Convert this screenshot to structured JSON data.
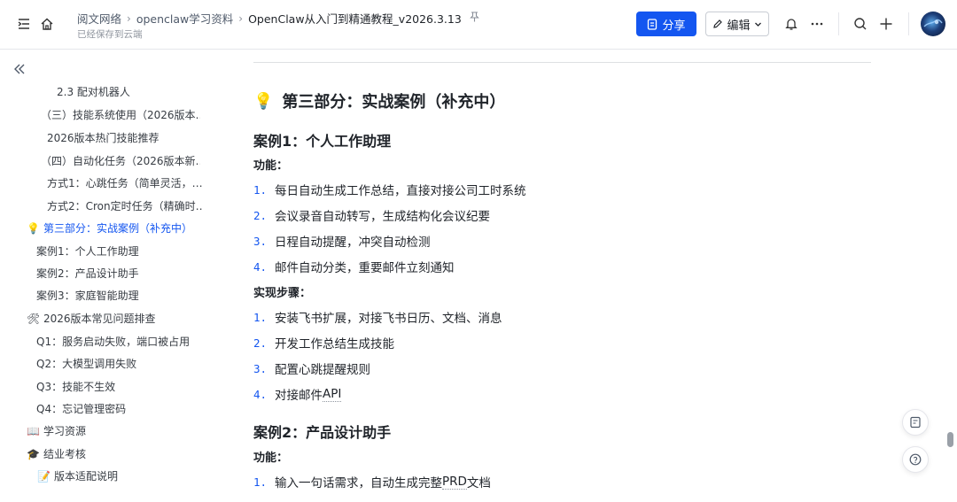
{
  "header": {
    "breadcrumbs": [
      "阅文网络",
      "openclaw学习资料",
      "OpenClaw从入门到精通教程_v2026.3.13"
    ],
    "saved_status": "已经保存到云端",
    "share_label": "分享",
    "edit_label": "编辑",
    "pin_icon": "pin-icon",
    "accent_color": "#1456f0"
  },
  "toc": {
    "items": [
      {
        "label": "2.3 配对机器人",
        "emoji": ""
      },
      {
        "label": "（三）技能系统使用（2026版本…",
        "emoji": ""
      },
      {
        "label": "2026版本热门技能推荐",
        "emoji": ""
      },
      {
        "label": "（四）自动化任务（2026版本新…",
        "emoji": ""
      },
      {
        "label": "方式1：心跳任务（简单灵活，…",
        "emoji": ""
      },
      {
        "label": "方式2：Cron定时任务（精确时…",
        "emoji": ""
      },
      {
        "label": "第三部分：实战案例（补充中）",
        "emoji": "💡"
      },
      {
        "label": "案例1：个人工作助理",
        "emoji": ""
      },
      {
        "label": "案例2：产品设计助手",
        "emoji": ""
      },
      {
        "label": "案例3：家庭智能助理",
        "emoji": ""
      },
      {
        "label": "2026版本常见问题排查",
        "emoji": "🛠"
      },
      {
        "label": "Q1：服务启动失败，端口被占用",
        "emoji": ""
      },
      {
        "label": "Q2：大模型调用失败",
        "emoji": ""
      },
      {
        "label": "Q3：技能不生效",
        "emoji": ""
      },
      {
        "label": "Q4：忘记管理密码",
        "emoji": ""
      },
      {
        "label": "学习资源",
        "emoji": "📖"
      },
      {
        "label": "结业考核",
        "emoji": "🎓"
      },
      {
        "label": "版本适配说明",
        "emoji": "📝"
      }
    ]
  },
  "content": {
    "section_emoji": "💡",
    "section_title": "第三部分：实战案例（补充中）",
    "case1_title": "案例1：个人工作助理",
    "case1_features_label": "功能：",
    "case1_features": [
      {
        "num": "1.",
        "text": "每日自动生成工作总结，直接对接公司工时系统"
      },
      {
        "num": "2.",
        "text": "会议录音自动转写，生成结构化会议纪要"
      },
      {
        "num": "3.",
        "text": "日程自动提醒，冲突自动检测"
      },
      {
        "num": "4.",
        "text": "邮件自动分类，重要邮件立刻通知"
      }
    ],
    "case1_steps_label": "实现步骤：",
    "case1_steps": [
      {
        "num": "1.",
        "text": "安装飞书扩展，对接飞书日历、文档、消息"
      },
      {
        "num": "2.",
        "text": "开发工作总结生成技能"
      },
      {
        "num": "3.",
        "text": "配置心跳提醒规则"
      },
      {
        "num": "4.",
        "text_a": "对接邮件",
        "text_b": "API"
      }
    ],
    "case2_title": "案例2：产品设计助手",
    "case2_features_label": "功能：",
    "case2_features": [
      {
        "num": "1.",
        "text_a": "输入一句话需求，自动生成完整",
        "text_b": "PRD",
        "text_c": "文档"
      }
    ]
  }
}
